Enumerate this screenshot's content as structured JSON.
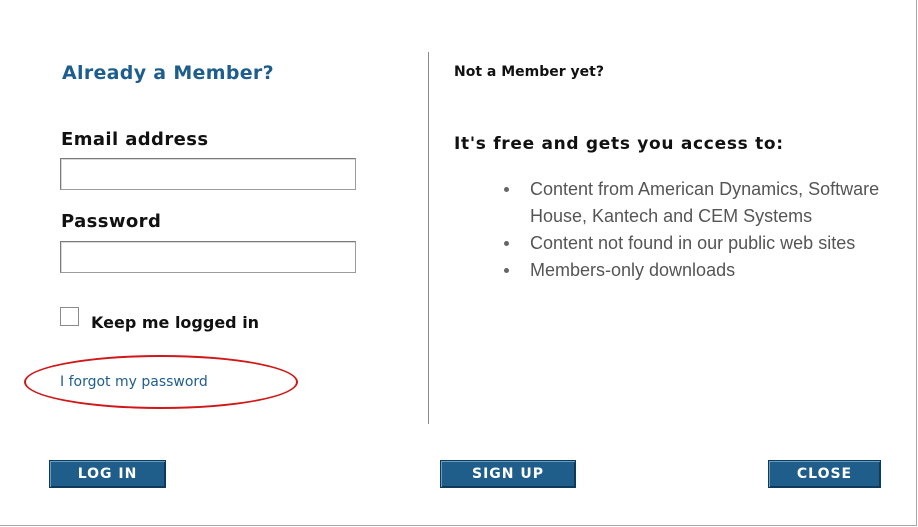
{
  "login": {
    "heading": "Already a Member?",
    "email_label": "Email address",
    "email_value": "",
    "password_label": "Password",
    "password_value": "",
    "keep_logged_in_label": "Keep me logged in",
    "keep_logged_in_checked": false,
    "forgot_password_link": "I forgot my password",
    "highlight_color": "#d01818"
  },
  "signup": {
    "heading": "Not a Member yet?",
    "subheading": "It's free and gets you access to:",
    "benefits": [
      "Content from American Dynamics, Software House, Kantech and CEM Systems",
      "Content not found in our public web sites",
      "Members-only downloads"
    ]
  },
  "buttons": {
    "login_label": "LOG IN",
    "signup_label": "SIGN UP",
    "close_label": "CLOSE",
    "color": "#1f5d8a"
  }
}
